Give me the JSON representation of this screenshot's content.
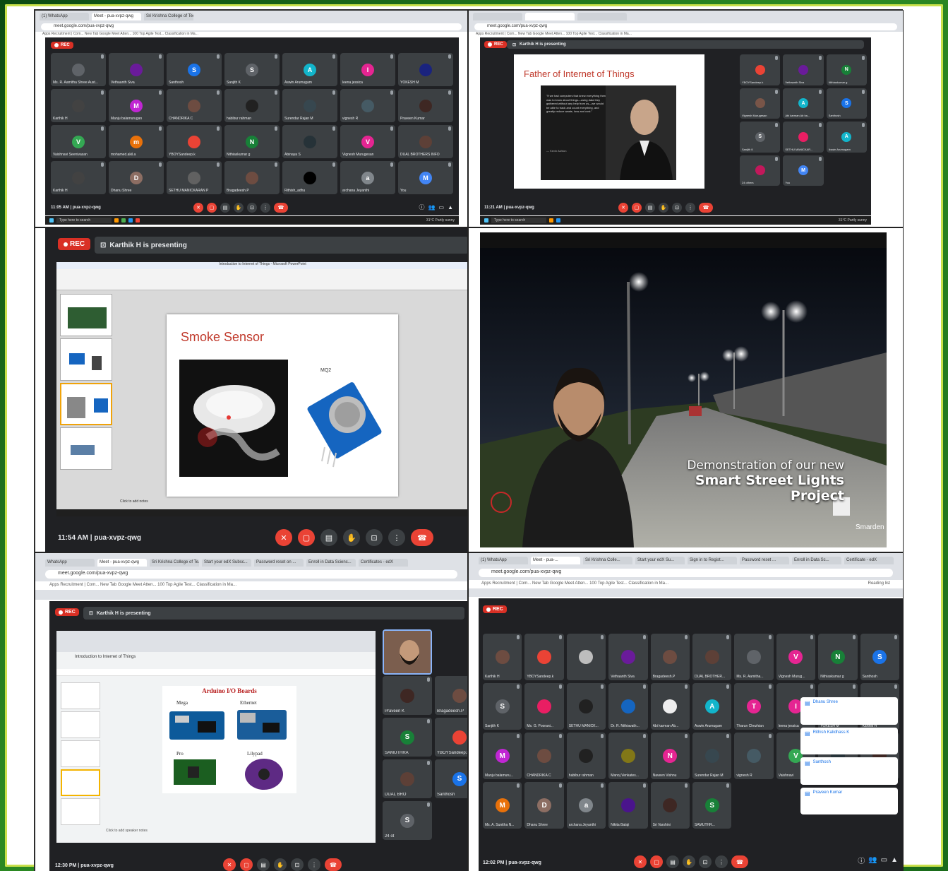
{
  "panel1": {
    "tabs": [
      "(1) WhatsApp",
      "Meet - pua-xvpz-qwg",
      "Sri Krishna College of Technolo..."
    ],
    "url": "meet.google.com/pua-xvpz-qwg",
    "bookmarks": "Apps  Recruitment | Com...  New Tab  Google Meet Atten...  100 Top Agile Test...  Classification in Ma...",
    "rec": "REC",
    "participants": [
      {
        "name": "Ms. R. Aamitha Shree Aust...",
        "initial": "",
        "color": "#5f6368"
      },
      {
        "name": "Vethaanth Siva",
        "initial": "",
        "color": "#6a1b9a"
      },
      {
        "name": "Santhosh",
        "initial": "S",
        "color": "#1a73e8"
      },
      {
        "name": "Sanjith K",
        "initial": "S",
        "color": "#5f6368"
      },
      {
        "name": "Aswin Arumugam",
        "initial": "A",
        "color": "#12b5cb"
      },
      {
        "name": "leena jessica",
        "initial": "I",
        "color": "#e52592"
      },
      {
        "name": "YOKESH M",
        "initial": "",
        "color": "#1a237e"
      },
      {
        "name": "Karthik H",
        "initial": "",
        "color": "#424242"
      },
      {
        "name": "Manju balamurugan",
        "initial": "M",
        "color": "#c026d3"
      },
      {
        "name": "CHANDRIKA C",
        "initial": "",
        "color": "#6d4c41"
      },
      {
        "name": "habibur rahman",
        "initial": "",
        "color": "#212121"
      },
      {
        "name": "Surendar Rajan M",
        "initial": "",
        "color": "#37474f"
      },
      {
        "name": "vignesh R",
        "initial": "",
        "color": "#455a64"
      },
      {
        "name": "Praveen Kumar",
        "initial": "",
        "color": "#3e2723"
      },
      {
        "name": "Vaishnavi Seenivasan",
        "initial": "V",
        "color": "#34a853"
      },
      {
        "name": "mohamed.akil.a",
        "initial": "m",
        "color": "#e8710a"
      },
      {
        "name": "YBOYSandeep.k",
        "initial": "",
        "color": "#ea4335"
      },
      {
        "name": "Nithiaskumar g",
        "initial": "N",
        "color": "#188038"
      },
      {
        "name": "Abinaya S",
        "initial": "",
        "color": "#263238"
      },
      {
        "name": "Vignesh Murugesan",
        "initial": "V",
        "color": "#e52592"
      },
      {
        "name": "DUAL BROTHERS INFO",
        "initial": "",
        "color": "#5d4037"
      },
      {
        "name": "Karthik H",
        "initial": "",
        "color": "#424242"
      },
      {
        "name": "Dhanu Shree",
        "initial": "D",
        "color": "#8d6e63"
      },
      {
        "name": "SETHU MANICKARAN P",
        "initial": "",
        "color": "#616161"
      },
      {
        "name": "Bragadeesh.P",
        "initial": "",
        "color": "#6d4c41"
      },
      {
        "name": "Rithish_adhu",
        "initial": "",
        "color": "#000000"
      },
      {
        "name": "archana Jeyanthi",
        "initial": "a",
        "color": "#80868b"
      },
      {
        "name": "You",
        "initial": "M",
        "color": "#4285f4"
      }
    ],
    "time": "11:05 AM",
    "code": "pua-xvpz-qwg",
    "search": "Type here to search",
    "weather": "31°C  Partly sunny"
  },
  "panel2": {
    "presenting": "Karthik H is presenting",
    "slide_title": "Father of Internet of Things",
    "quote": "\"If we had computers that knew everything there was to know about things—using data they gathered without any help from us—we would be able to track and count everything, and greatly reduce waste, loss and cost.\"",
    "quote_author": "— Kevin Ashton",
    "participants": [
      {
        "name": "YBOYSandeep.k",
        "initial": "",
        "color": "#ea4335"
      },
      {
        "name": "Vethaanth Siva",
        "initial": "",
        "color": "#6a1b9a"
      },
      {
        "name": "Nithiaskumar g",
        "initial": "N",
        "color": "#188038"
      },
      {
        "name": "Vignesh Murugesan",
        "initial": "",
        "color": "#795548"
      },
      {
        "name": "Abi karman Ab ha...",
        "initial": "A",
        "color": "#12b5cb"
      },
      {
        "name": "Santhosh",
        "initial": "S",
        "color": "#1a73e8"
      },
      {
        "name": "Sanjith K",
        "initial": "S",
        "color": "#5f6368"
      },
      {
        "name": "SETHU MANICKAR...",
        "initial": "",
        "color": "#e91e63"
      },
      {
        "name": "Aswin Arumugam",
        "initial": "A",
        "color": "#12b5cb"
      },
      {
        "name": "24 others",
        "initial": "",
        "color": "#c2185b"
      },
      {
        "name": "You",
        "initial": "M",
        "color": "#4285f4"
      }
    ],
    "time": "11:21 AM",
    "code": "pua-xvpz-qwg"
  },
  "panel3": {
    "rec": "REC",
    "presenting": "Karthik H is presenting",
    "ppt_title": "Introduction to Internet of Things - Microsoft PowerPoint",
    "slide_title": "Smoke Sensor",
    "sensor_label": "MQ2",
    "notes": "Click to add notes",
    "time": "11:54 AM",
    "code": "pua-xvpz-qwg"
  },
  "panel4": {
    "caption_line1": "Demonstration of our new",
    "caption_line2": "Smart Street Lights Project",
    "brand": "Smarden"
  },
  "panel5": {
    "tabs": [
      "WhatsApp",
      "Meet - pua-xvpz-qwg",
      "Sri Krishna College of Te...",
      "Start your edX Subsc...",
      "Password reset on ...",
      "Enroll in Data Scienc...",
      "Certificates - edX"
    ],
    "url": "meet.google.com/pua-xvpz-qwg",
    "bookmarks": "Apps  Recruitment | Com...  New Tab  Google Meet Atten...  100 Top Agile Test...  Classification in Ma...",
    "rec": "REC",
    "presenting": "Karthik H is presenting",
    "doc_title": "Introduction to Internet of Things",
    "slide_title": "Arduino I/O Boards",
    "boards": [
      "Mega",
      "Ethernet",
      "Pro",
      "Lilypad"
    ],
    "speaker_notes": "Click to add speaker notes",
    "side": [
      {
        "name": "Praveen K",
        "initial": "",
        "color": "#3e2723"
      },
      {
        "name": "Bragadeesh.P",
        "initial": "",
        "color": "#6d4c41"
      },
      {
        "name": "SAMUTHRA",
        "initial": "S",
        "color": "#188038"
      },
      {
        "name": "YBOYSandeep.k",
        "initial": "",
        "color": "#ea4335"
      },
      {
        "name": "DUAL BRO",
        "initial": "",
        "color": "#5d4037"
      },
      {
        "name": "Santhosh",
        "initial": "S",
        "color": "#1a73e8"
      },
      {
        "name": "24 ot",
        "initial": "S",
        "color": "#5f6368"
      }
    ],
    "time": "12:30 PM",
    "code": "pua-xvpz-qwg"
  },
  "panel6": {
    "tabs": [
      "(1) WhatsApp",
      "Meet - pua-...",
      "Sri Krishna Colle...",
      "Start your edX Su...",
      "Sign in to Regist...",
      "Password reset ...",
      "Enroll in Data Sc...",
      "Certificate - edX"
    ],
    "url": "meet.google.com/pua-xvpz-qwg",
    "bookmarks": "Apps  Recruitment | Com...  New Tab  Google Meet Atten...  100 Top Agile Test...  Classification in Ma...",
    "reading_list": "Reading list",
    "rec": "REC",
    "participants": [
      {
        "name": "Karthik H",
        "initial": "",
        "color": "#6d4c41"
      },
      {
        "name": "YBOYSandeep.k",
        "initial": "",
        "color": "#ea4335"
      },
      {
        "name": "",
        "initial": "",
        "color": "#bdbdbd"
      },
      {
        "name": "Vethaanth Siva",
        "initial": "",
        "color": "#6a1b9a"
      },
      {
        "name": "Bragadeesh.P",
        "initial": "",
        "color": "#6d4c41"
      },
      {
        "name": "DUAL BROTHER...",
        "initial": "",
        "color": "#5d4037"
      },
      {
        "name": "Ms. R. Aamitha...",
        "initial": "",
        "color": "#5f6368"
      },
      {
        "name": "Vignesh Murug...",
        "initial": "V",
        "color": "#e52592"
      },
      {
        "name": "Nithiaskumar g",
        "initial": "N",
        "color": "#188038"
      },
      {
        "name": "Santhosh",
        "initial": "S",
        "color": "#1a73e8"
      },
      {
        "name": "Sanjith K",
        "initial": "S",
        "color": "#5f6368"
      },
      {
        "name": "Ms. G. Poorani...",
        "initial": "",
        "color": "#e91e63"
      },
      {
        "name": "SETHU MANICK...",
        "initial": "",
        "color": "#212121"
      },
      {
        "name": "Dr. R. Nithiavath...",
        "initial": "",
        "color": "#1565c0"
      },
      {
        "name": "Abi karman Ab...",
        "initial": "",
        "color": "#eeeeee"
      },
      {
        "name": "Aswin Arumugam",
        "initial": "A",
        "color": "#12b5cb"
      },
      {
        "name": "Tharun Chezhian",
        "initial": "T",
        "color": "#e52592"
      },
      {
        "name": "leena jessica",
        "initial": "I",
        "color": "#e52592"
      },
      {
        "name": "YOKESH M",
        "initial": "",
        "color": "#1a237e"
      },
      {
        "name": "Karthik H",
        "initial": "",
        "color": "#424242"
      },
      {
        "name": "Manju balamuru...",
        "initial": "M",
        "color": "#c026d3"
      },
      {
        "name": "CHANDRIKA C",
        "initial": "",
        "color": "#6d4c41"
      },
      {
        "name": "habibur rahman",
        "initial": "",
        "color": "#212121"
      },
      {
        "name": "Manoj Venkates...",
        "initial": "",
        "color": "#827717"
      },
      {
        "name": "Naveen Vishnu",
        "initial": "N",
        "color": "#e52592"
      },
      {
        "name": "Surendar Rajan M",
        "initial": "",
        "color": "#37474f"
      },
      {
        "name": "vignesh R",
        "initial": "",
        "color": "#455a64"
      },
      {
        "name": "Vaishnavi",
        "initial": "V",
        "color": "#34a853"
      },
      {
        "name": "Abinaya S",
        "initial": "",
        "color": "#263238"
      },
      {
        "name": "Praveen Kumar",
        "initial": "",
        "color": "#3e2723"
      },
      {
        "name": "Ms. A. Sunitha N...",
        "initial": "M",
        "color": "#e8710a"
      },
      {
        "name": "Dhanu Shree",
        "initial": "D",
        "color": "#8d6e63"
      },
      {
        "name": "archana Jeyanthi",
        "initial": "a",
        "color": "#80868b"
      },
      {
        "name": "Nikita Balaji",
        "initial": "",
        "color": "#4a148c"
      },
      {
        "name": "Sri Varshini",
        "initial": "",
        "color": "#3e2723"
      },
      {
        "name": "SAMUTHR...",
        "initial": "S",
        "color": "#188038"
      }
    ],
    "notifications": [
      "Dhanu Shree",
      "Rithish Kalidhass K",
      "Santhosh",
      "Praveen Kumar"
    ],
    "time": "12:02 PM",
    "code": "pua-xvpz-qwg"
  },
  "colors": {
    "meet_bg": "#202124",
    "tile": "#3c4043",
    "red": "#ea4335",
    "frame_green": "#2c8a23"
  }
}
